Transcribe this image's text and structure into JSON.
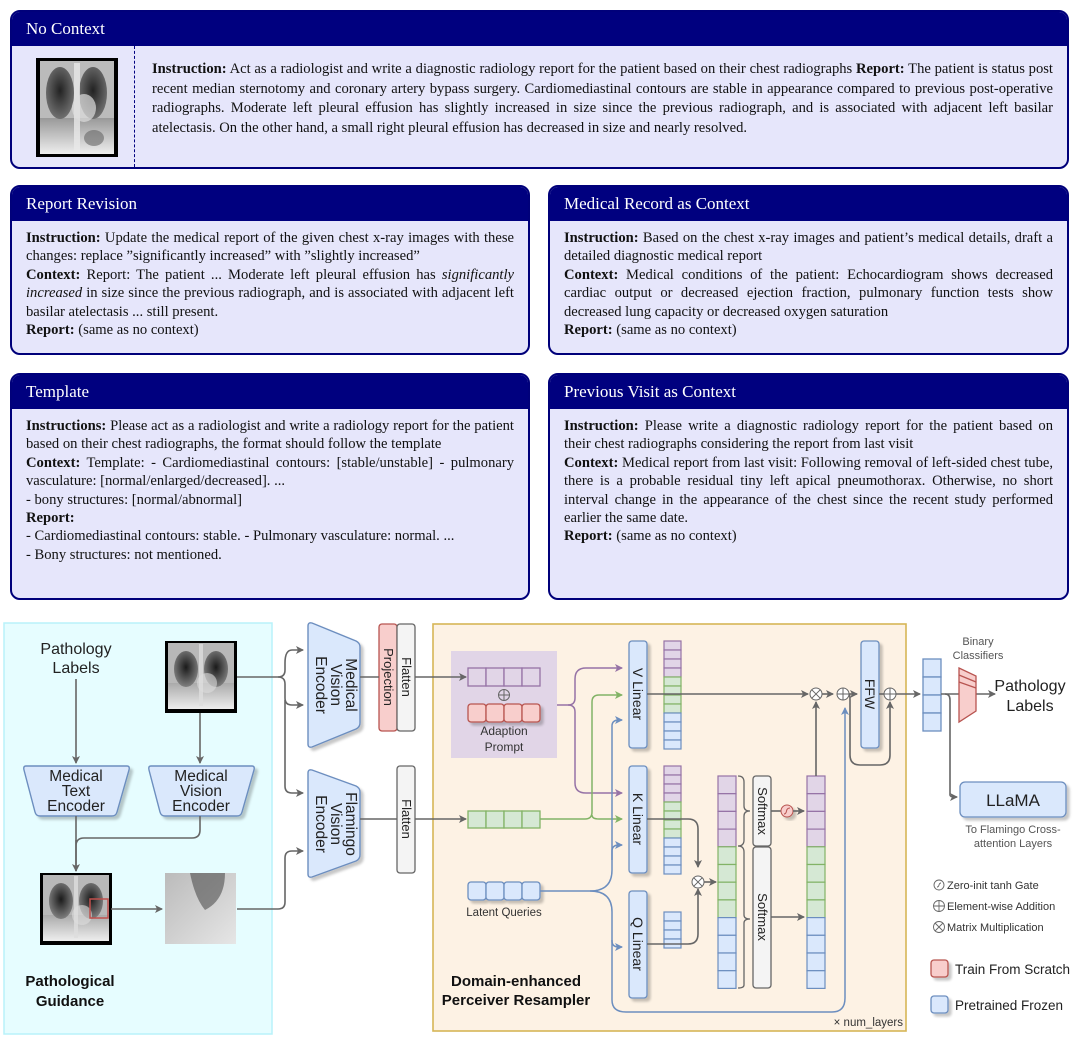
{
  "cards": {
    "no_context": {
      "title": "No Context",
      "instruction_label": "Instruction:",
      "instruction": " Act as a radiologist and write a diagnostic radiology report for the patient based on their chest radiographs",
      "report_label": "Report:",
      "report": "  The patient is status post recent median sternotomy and coronary artery bypass surgery.  Cardiomediastinal contours are stable in appearance compared to previous post-operative radiographs.  Moderate left pleural effusion has slightly increased in size since the previous radiograph, and is associated with adjacent left basilar atelectasis.  On the other hand, a small right pleural effusion has decreased in size and nearly resolved."
    },
    "report_revision": {
      "title": "Report Revision",
      "instruction_label": "Instruction:",
      "instruction": " Update the medical report of the given chest x-ray images with these changes: replace ”significantly increased” with ”slightly increased”",
      "context_label": "Context:",
      "context_pre": " Report: The patient ...  Moderate left pleural effusion has ",
      "context_em": "significantly increased",
      "context_post": " in size since the previous radiograph, and is associated with adjacent left basilar atelectasis ... still present.",
      "report_label": "Report:",
      "report": " (same as no context)"
    },
    "medical_record": {
      "title": "Medical Record as Context",
      "instruction_label": "Instruction:",
      "instruction": " Based on the chest x-ray images and patient’s medical details, draft a detailed diagnostic medical report",
      "context_label": "Context:",
      "context": "  Medical conditions of the patient:  Echocardiogram shows decreased cardiac output or decreased ejection fraction, pulmonary function tests show decreased lung capacity or decreased oxygen saturation",
      "report_label": "Report:",
      "report": " (same as no context)"
    },
    "template": {
      "title": "Template",
      "instruction_label": "Instructions:",
      "instruction": " Please act as a radiologist and write a radiology report for the patient based on their chest radiographs, the format should follow the template",
      "context_label": "Context:",
      "context": "  Template:  - Cardiomediastinal contours:  [stable/unstable]  - pulmonary vasculature: [normal/enlarged/decreased]. ...",
      "context_line2": "- bony structures: [normal/abnormal]",
      "report_label": "Report:",
      "report_line1": "- Cardiomediastinal contours: stable. - Pulmonary vasculature: normal. ...",
      "report_line2": "- Bony structures: not mentioned."
    },
    "previous_visit": {
      "title": "Previous Visit as Context",
      "instruction_label": "Instruction:",
      "instruction": " Please write a diagnostic radiology report for the patient based on their chest radiographs considering the report from last visit",
      "context_label": "Context:",
      "context": "  Medical report from last visit:  Following removal of left-sided chest tube, there is a probable residual tiny left apical pneumothorax. Otherwise, no short interval change in the appearance of the chest since the recent study performed earlier the same date.",
      "report_label": "Report:",
      "report": " (same as no context)"
    }
  },
  "diagram": {
    "pathology_labels_input": [
      "Pathology",
      "Labels"
    ],
    "medical_text_encoder": [
      "Medical",
      "Text",
      "Encoder"
    ],
    "medical_vision_encoder_left": [
      "Medical",
      "Vision",
      "Encoder"
    ],
    "pathological_guidance": [
      "Pathological",
      "Guidance"
    ],
    "medical_vision_encoder": [
      "Medical",
      "Vision",
      "Encoder"
    ],
    "flamingo_vision_encoder": [
      "Flamingo",
      "Vision",
      "Encoder"
    ],
    "projection": "Projection",
    "flatten_top": "Flatten",
    "flatten_bottom": "Flatten",
    "adaption_prompt": [
      "Adaption",
      "Prompt"
    ],
    "latent_queries": "Latent Queries",
    "v_linear": "V Linear",
    "k_linear": "K Linear",
    "q_linear": "Q Linear",
    "softmax_top": "Softmax",
    "softmax_bottom": "Softmax",
    "ffw": "FFW",
    "resampler_title": [
      "Domain-enhanced",
      "Perceiver Resampler"
    ],
    "num_layers": "× num_layers",
    "binary_classifiers": [
      "Binary",
      "Classifiers"
    ],
    "pathology_labels_output": [
      "Pathology",
      "Labels"
    ],
    "llama": "LLaMA",
    "llama_caption": [
      "To Flamingo Cross-",
      "attention Layers"
    ]
  },
  "legend": {
    "gate": "Zero-init tanh Gate",
    "add": "Element-wise Addition",
    "mul": "Matrix Multiplication",
    "train": "Train From Scratch",
    "frozen": "Pretrained Frozen"
  },
  "colors": {
    "card_header": "#00007f",
    "card_body": "#e6e6fb",
    "guidance_bg": "#e8fdff",
    "resampler_bg": "#fdf2e4",
    "resampler_border": "#d6b656",
    "frozen_fill": "#dae8fc",
    "frozen_stroke": "#6c8ebf",
    "train_fill": "#f8cecc",
    "train_stroke": "#b85450",
    "purple_fill": "#e1d5e7",
    "purple_stroke": "#9673a6",
    "green_fill": "#d5e8d4",
    "green_stroke": "#82b366"
  }
}
